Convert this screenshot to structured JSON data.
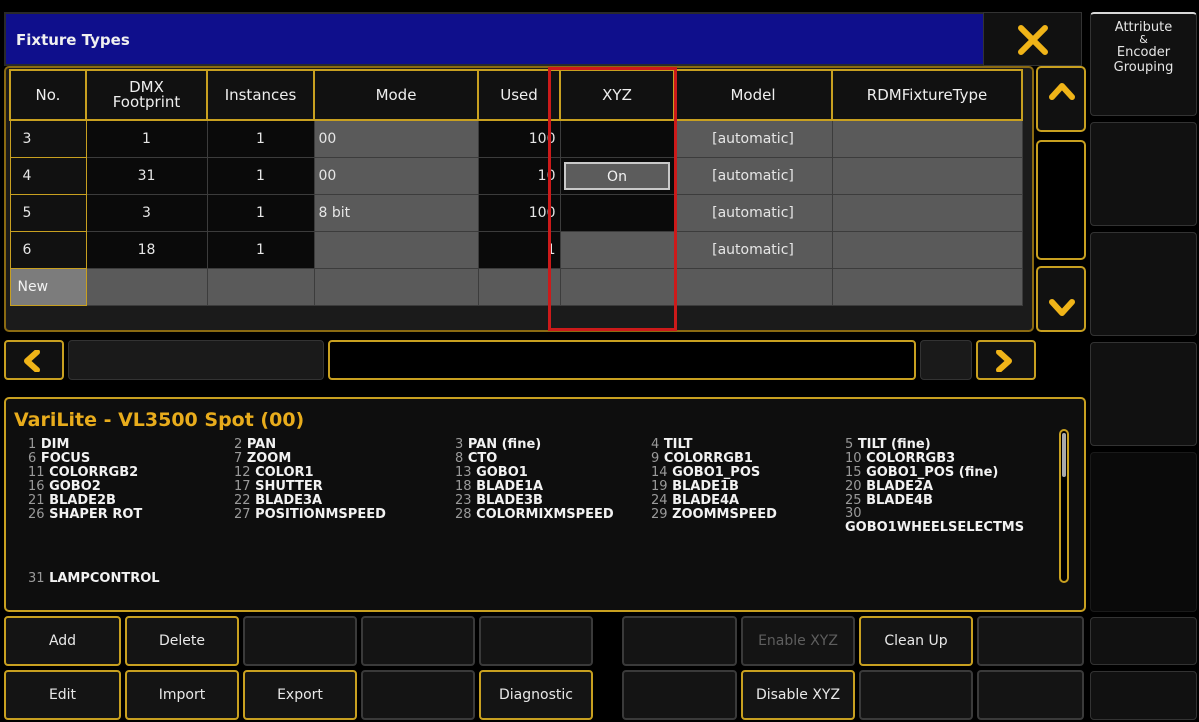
{
  "window": {
    "title": "Fixture Types",
    "close_icon": "close-icon"
  },
  "side": {
    "title_l1": "Attribute",
    "title_l2": "&",
    "title_l3": "Encoder",
    "title_l4": "Grouping"
  },
  "table": {
    "headers": [
      "No.",
      "DMX Footprint",
      "Instances",
      "Mode",
      "Used",
      "XYZ",
      "Model",
      "RDMFixtureType"
    ],
    "header_dmx_l1": "DMX",
    "header_dmx_l2": "Footprint",
    "rows": [
      {
        "no": "3",
        "dmx": "1",
        "instances": "1",
        "mode": "00",
        "used": "100",
        "xyz": "",
        "model": "[automatic]",
        "rdm": ""
      },
      {
        "no": "4",
        "dmx": "31",
        "instances": "1",
        "mode": "00",
        "used": "10",
        "xyz": "On",
        "model": "[automatic]",
        "rdm": ""
      },
      {
        "no": "5",
        "dmx": "3",
        "instances": "1",
        "mode": "8 bit",
        "used": "100",
        "xyz": "",
        "model": "[automatic]",
        "rdm": ""
      },
      {
        "no": "6",
        "dmx": "18",
        "instances": "1",
        "mode": "",
        "used": "1",
        "xyz": "",
        "model": "[automatic]",
        "rdm": ""
      }
    ],
    "new_label": "New"
  },
  "info": {
    "title": "VariLite - VL3500 Spot (00)",
    "channels": [
      {
        "n": "1",
        "name": "DIM"
      },
      {
        "n": "2",
        "name": "PAN"
      },
      {
        "n": "3",
        "name": "PAN (fine)"
      },
      {
        "n": "4",
        "name": "TILT"
      },
      {
        "n": "5",
        "name": "TILT (fine)"
      },
      {
        "n": "6",
        "name": "FOCUS"
      },
      {
        "n": "7",
        "name": "ZOOM"
      },
      {
        "n": "8",
        "name": "CTO"
      },
      {
        "n": "9",
        "name": "COLORRGB1"
      },
      {
        "n": "10",
        "name": "COLORRGB3"
      },
      {
        "n": "11",
        "name": "COLORRGB2"
      },
      {
        "n": "12",
        "name": "COLOR1"
      },
      {
        "n": "13",
        "name": "GOBO1"
      },
      {
        "n": "14",
        "name": "GOBO1_POS"
      },
      {
        "n": "15",
        "name": "GOBO1_POS (fine)"
      },
      {
        "n": "16",
        "name": "GOBO2"
      },
      {
        "n": "17",
        "name": "SHUTTER"
      },
      {
        "n": "18",
        "name": "BLADE1A"
      },
      {
        "n": "19",
        "name": "BLADE1B"
      },
      {
        "n": "20",
        "name": "BLADE2A"
      },
      {
        "n": "21",
        "name": "BLADE2B"
      },
      {
        "n": "22",
        "name": "BLADE3A"
      },
      {
        "n": "23",
        "name": "BLADE3B"
      },
      {
        "n": "24",
        "name": "BLADE4A"
      },
      {
        "n": "25",
        "name": "BLADE4B"
      },
      {
        "n": "26",
        "name": "SHAPER ROT"
      },
      {
        "n": "27",
        "name": "POSITIONMSPEED"
      },
      {
        "n": "28",
        "name": "COLORMIXMSPEED"
      },
      {
        "n": "29",
        "name": "ZOOMMSPEED"
      },
      {
        "n": "30",
        "name": "GOBO1WHEELSELECTMS"
      },
      {
        "n": "31",
        "name": "LAMPCONTROL"
      }
    ]
  },
  "buttons": {
    "add": "Add",
    "delete": "Delete",
    "enable_xyz": "Enable XYZ",
    "clean_up": "Clean Up",
    "edit": "Edit",
    "import": "Import",
    "export": "Export",
    "diagnostic": "Diagnostic",
    "disable_xyz": "Disable XYZ"
  },
  "colors": {
    "accent": "#c8a020",
    "title_bar": "#0f0f8c",
    "highlight": "#cc1a1a",
    "info_title": "#e8ac1c"
  }
}
